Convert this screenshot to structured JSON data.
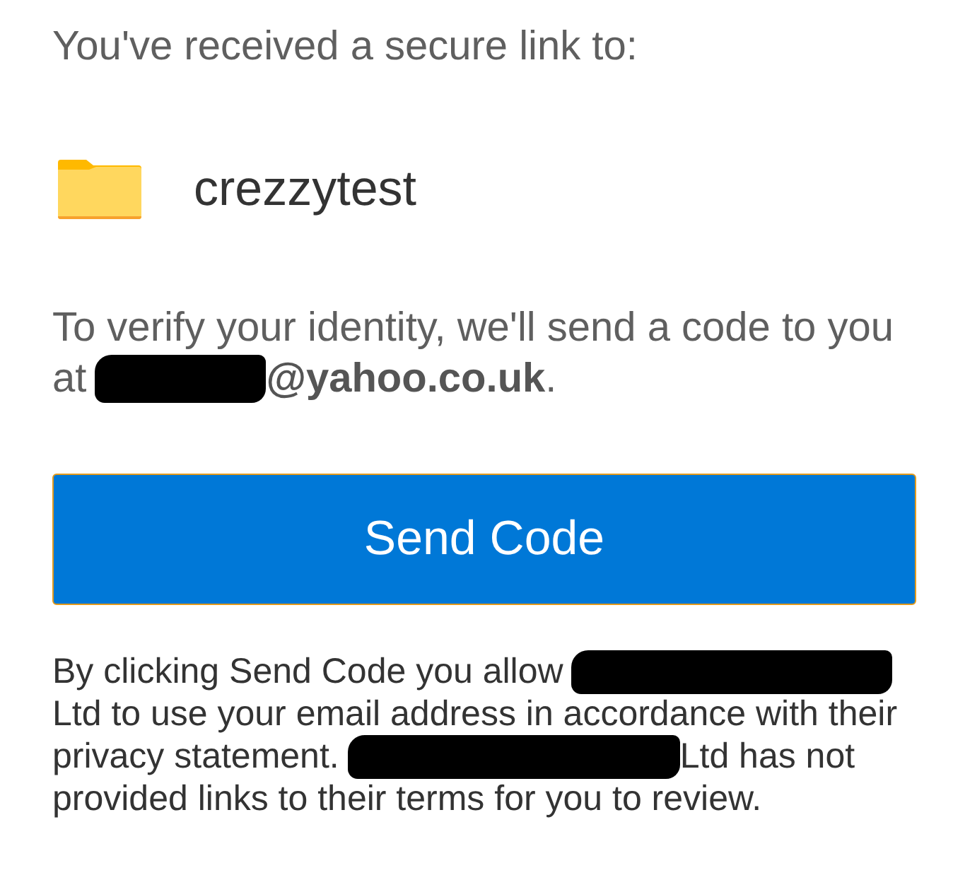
{
  "heading": {
    "text": "You've received a secure link to:"
  },
  "shared_item": {
    "name": "crezzytest"
  },
  "verification": {
    "lines": [
      [
        {
          "kind": "text",
          "text": "To verify your identity, we'll send a code to you"
        }
      ],
      [
        {
          "kind": "text",
          "text": "at"
        },
        {
          "kind": "redaction"
        },
        {
          "kind": "text",
          "text": "**@yahoo.co.uk**."
        }
      ]
    ]
  },
  "send_button": {
    "label": "Send Code"
  },
  "consent": {
    "lines": [
      [
        {
          "kind": "text",
          "text": "By clicking Send Code you allow"
        },
        {
          "kind": "redaction"
        }
      ],
      [
        {
          "kind": "text",
          "text": "Ltd to use your email address in accordance with their"
        }
      ],
      [
        {
          "kind": "text",
          "text": "privacy statement."
        },
        {
          "kind": "redaction"
        },
        {
          "kind": "text",
          "text": "Ltd has not"
        }
      ],
      [
        {
          "kind": "text",
          "text": "provided links to their terms for you to review."
        }
      ]
    ]
  }
}
